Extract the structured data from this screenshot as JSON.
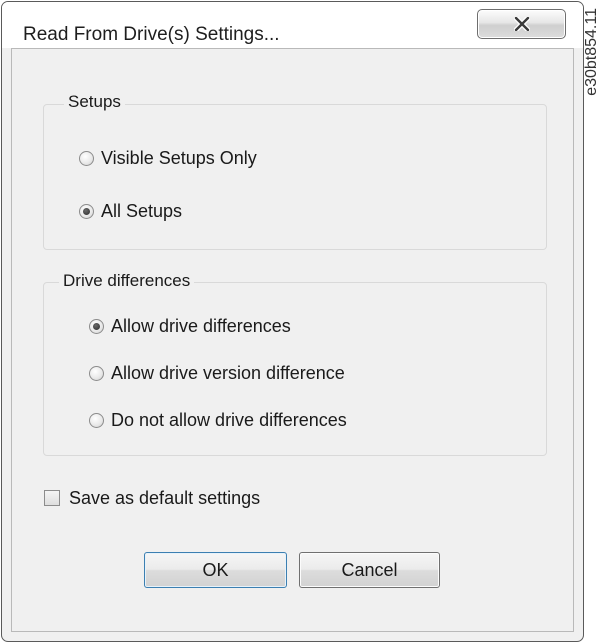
{
  "window": {
    "title": "Read From Drive(s) Settings...",
    "close_icon": "close-x-icon"
  },
  "setups": {
    "legend": "Setups",
    "options": [
      {
        "label": "Visible Setups Only",
        "selected": false
      },
      {
        "label": "All Setups",
        "selected": true
      }
    ]
  },
  "drive_differences": {
    "legend": "Drive differences",
    "options": [
      {
        "label": "Allow drive differences",
        "selected": true
      },
      {
        "label": "Allow drive version difference",
        "selected": false
      },
      {
        "label": "Do not allow drive differences",
        "selected": false
      }
    ]
  },
  "save_default": {
    "label": "Save as default settings",
    "checked": false
  },
  "buttons": {
    "ok_label": "OK",
    "cancel_label": "Cancel"
  },
  "figure_id": "e30bt854.11",
  "colors": {
    "dialog_bg": "#f0f0f0",
    "titlebar_bg": "#ffffff",
    "default_button_border": "#3c7fb1"
  }
}
